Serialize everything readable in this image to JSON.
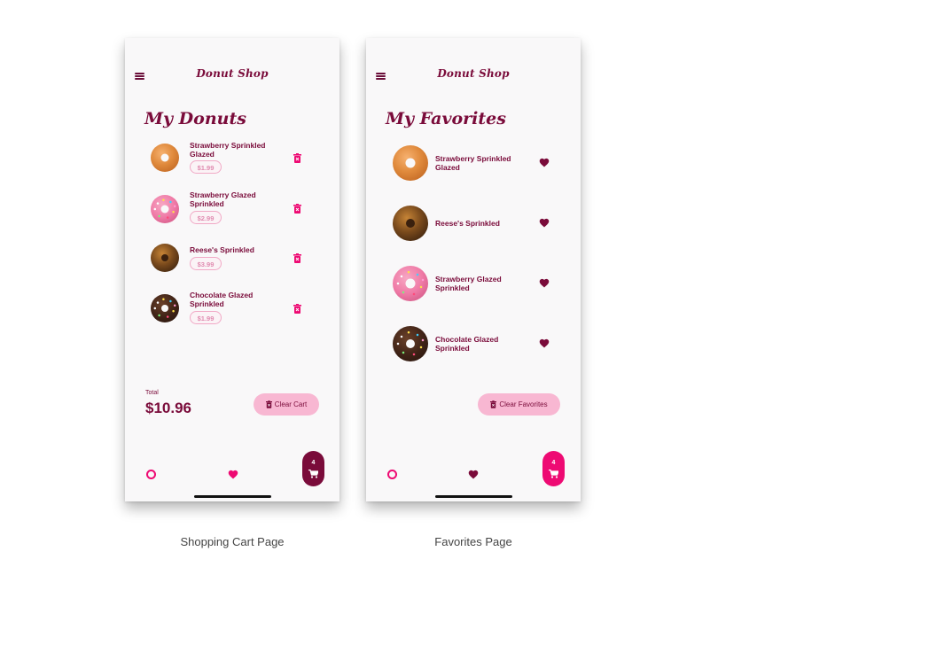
{
  "colors": {
    "brand": "#7a0b3a",
    "accent": "#ee0a73",
    "pill": "#f8b7d2"
  },
  "cart_page": {
    "app_title": "Donut Shop",
    "heading": "My Donuts",
    "items": [
      {
        "name": "Strawberry Sprinkled Glazed",
        "price": "$1.99",
        "image": "glazed-donut"
      },
      {
        "name": "Strawberry Glazed Sprinkled",
        "price": "$2.99",
        "image": "pink-sprinkled-donut"
      },
      {
        "name": "Reese's Sprinkled",
        "price": "$3.99",
        "image": "reese-donut"
      },
      {
        "name": "Chocolate Glazed Sprinkled",
        "price": "$1.99",
        "image": "chocolate-sprinkled-donut"
      }
    ],
    "total_label": "Total",
    "total_value": "$10.96",
    "clear_button": "Clear Cart",
    "cart_count": "4",
    "caption": "Shopping Cart Page"
  },
  "favorites_page": {
    "app_title": "Donut Shop",
    "heading": "My Favorites",
    "items": [
      {
        "name": "Strawberry Sprinkled Glazed",
        "image": "glazed-donut"
      },
      {
        "name": "Reese's Sprinkled",
        "image": "reese-donut"
      },
      {
        "name": "Strawberry Glazed Sprinkled",
        "image": "pink-sprinkled-donut"
      },
      {
        "name": "Chocolate Glazed Sprinkled",
        "image": "chocolate-sprinkled-donut"
      }
    ],
    "clear_button": "Clear Favorites",
    "cart_count": "4",
    "caption": "Favorites Page"
  }
}
